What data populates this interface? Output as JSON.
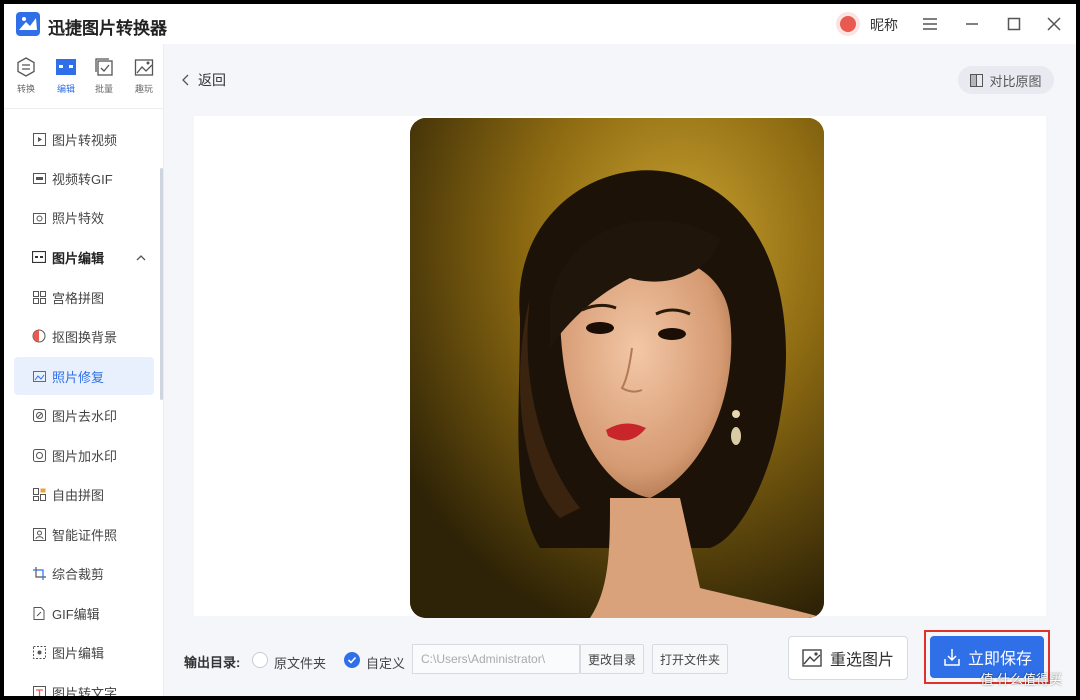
{
  "app": {
    "title": "迅捷图片转换器",
    "nickname": "昵称"
  },
  "top_tabs": [
    {
      "label": "转换",
      "icon": "convert-icon"
    },
    {
      "label": "编辑",
      "icon": "edit-icon",
      "active": true
    },
    {
      "label": "批量",
      "icon": "batch-icon"
    },
    {
      "label": "趣玩",
      "icon": "fun-icon"
    }
  ],
  "sidebar": {
    "items": [
      {
        "label": "图片转视频",
        "icon": "image-to-video-icon"
      },
      {
        "label": "视频转GIF",
        "icon": "video-to-gif-icon"
      },
      {
        "label": "照片特效",
        "icon": "photo-effect-icon"
      },
      {
        "label": "图片编辑",
        "icon": "image-edit-group-icon",
        "group": true
      },
      {
        "label": "宫格拼图",
        "icon": "grid-collage-icon"
      },
      {
        "label": "抠图换背景",
        "icon": "cutout-icon"
      },
      {
        "label": "照片修复",
        "icon": "photo-repair-icon",
        "active": true
      },
      {
        "label": "图片去水印",
        "icon": "remove-watermark-icon"
      },
      {
        "label": "图片加水印",
        "icon": "add-watermark-icon"
      },
      {
        "label": "自由拼图",
        "icon": "free-collage-icon"
      },
      {
        "label": "智能证件照",
        "icon": "id-photo-icon"
      },
      {
        "label": "综合裁剪",
        "icon": "crop-icon"
      },
      {
        "label": "GIF编辑",
        "icon": "gif-edit-icon"
      },
      {
        "label": "图片编辑",
        "icon": "image-edit-icon"
      },
      {
        "label": "图片转文字",
        "icon": "image-to-text-icon"
      }
    ]
  },
  "main": {
    "back_label": "返回",
    "compare_label": "对比原图"
  },
  "bottom": {
    "output_label": "输出目录:",
    "option_original": "原文件夹",
    "option_custom": "自定义",
    "path_value": "C:\\Users\\Administrator\\",
    "change_dir_label": "更改目录",
    "open_folder_label": "打开文件夹",
    "reselect_label": "重选图片",
    "save_label": "立即保存"
  },
  "watermark": "值 什么值得买",
  "colors": {
    "accent": "#2f6fe8",
    "highlight_border": "#e0322a"
  }
}
